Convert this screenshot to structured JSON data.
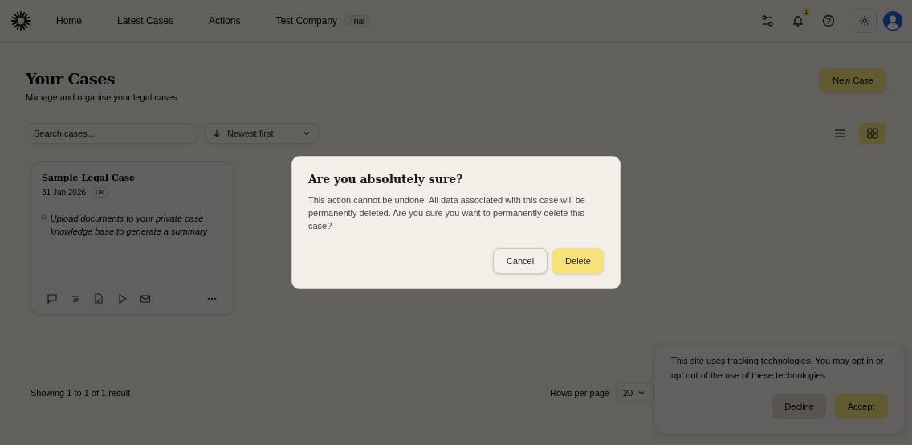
{
  "nav": {
    "links": [
      "Home",
      "Latest Cases",
      "Actions",
      "Test Company"
    ],
    "badge": "Trial",
    "notifications": "1"
  },
  "header": {
    "title": "Your Cases",
    "subtitle": "Manage and organise your legal cases",
    "new_button": "New Case"
  },
  "toolbar": {
    "search": {
      "placeholder": "Search cases..."
    },
    "sort": "Newest first",
    "views": [
      {
        "kind": "list",
        "selected": false
      },
      {
        "kind": "grid",
        "selected": true
      }
    ]
  },
  "cases": [
    {
      "title": "Sample Legal Case",
      "date": "31 Jan 2026",
      "region": "UK",
      "summary": "Upload documents to your private case knowledge base to generate a summary"
    }
  ],
  "footer": {
    "showing": "Showing 1 to 1 of 1 result",
    "rows_label": "Rows per page",
    "rows_value": "20"
  },
  "dialog": {
    "title": "Are you absolutely sure?",
    "text": "This action cannot be undone. All data associated with this case will be permanently deleted. Are you sure you want to permanently delete this case?",
    "buttons": [
      {
        "label": "Cancel",
        "kind": "secondary"
      },
      {
        "label": "Delete",
        "kind": "primary"
      }
    ]
  },
  "cookie": {
    "text": "This site uses tracking technologies. You may opt in or opt out of the use of these technologies.",
    "buttons": [
      {
        "label": "Decline",
        "kind": "secondary"
      },
      {
        "label": "Accept",
        "kind": "primary"
      }
    ]
  }
}
